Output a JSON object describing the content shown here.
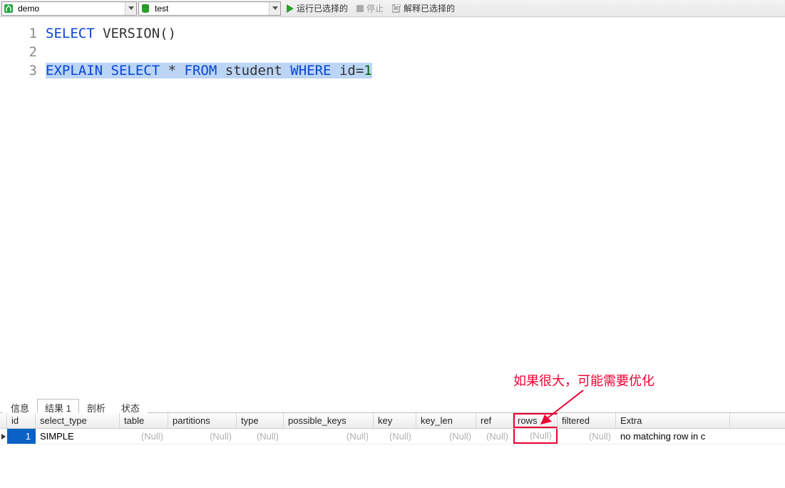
{
  "toolbar": {
    "connection": "demo",
    "database": "test",
    "run_label": "运行已选择的",
    "stop_label": "停止",
    "explain_label": "解释已选择的"
  },
  "editor": {
    "lines": [
      "1",
      "2",
      "3"
    ],
    "line1_kw1": "SELECT",
    "line1_fn": "VERSION",
    "line1_paren": "()",
    "line3_kw1": "EXPLAIN",
    "line3_kw2": "SELECT",
    "line3_star": "*",
    "line3_kw3": "FROM",
    "line3_tbl": "student",
    "line3_kw4": "WHERE",
    "line3_col": "id",
    "line3_eq": "=",
    "line3_val": "1"
  },
  "tabs": {
    "info": "信息",
    "result": "结果 1",
    "profile": "剖析",
    "status": "状态"
  },
  "grid": {
    "headers": {
      "id": "id",
      "select_type": "select_type",
      "table": "table",
      "partitions": "partitions",
      "type": "type",
      "possible_keys": "possible_keys",
      "key": "key",
      "key_len": "key_len",
      "ref": "ref",
      "rows": "rows",
      "filtered": "filtered",
      "Extra": "Extra"
    },
    "row": {
      "id": "1",
      "select_type": "SIMPLE",
      "table": "(Null)",
      "partitions": "(Null)",
      "type": "(Null)",
      "possible_keys": "(Null)",
      "key": "(Null)",
      "key_len": "(Null)",
      "ref": "(Null)",
      "rows": "(Null)",
      "filtered": "(Null)",
      "Extra": "no matching row in c"
    }
  },
  "annotation": {
    "text": "如果很大，可能需要优化"
  },
  "col_widths": {
    "rowmark": 10,
    "id": 40,
    "select_type": 118,
    "table": 68,
    "partitions": 96,
    "type": 66,
    "possible_keys": 126,
    "key": 60,
    "key_len": 84,
    "ref": 52,
    "rows": 62,
    "filtered": 82,
    "Extra": 160
  }
}
